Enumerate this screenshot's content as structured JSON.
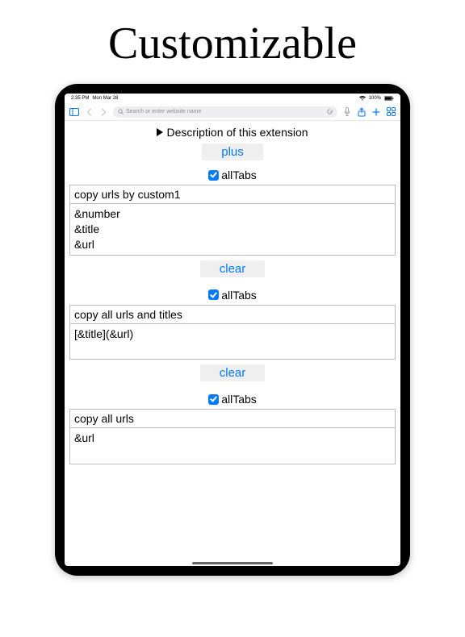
{
  "hero": {
    "title": "Customizable"
  },
  "statusbar": {
    "time": "2:35 PM",
    "date": "Mon Mar 28",
    "battery": "100%"
  },
  "toolbar": {
    "search_placeholder": "Search or enter website name"
  },
  "page": {
    "description_label": "Description of this extension",
    "plus_label": "plus",
    "clear_label": "clear",
    "alltabs_label": "allTabs",
    "sections": [
      {
        "title": "copy urls by custom1",
        "template": "&number\n&title\n&url",
        "template_rows": 3
      },
      {
        "title": "copy all urls and titles",
        "template": "[&title](&url)",
        "template_rows": 2
      },
      {
        "title": "copy all urls",
        "template": "&url",
        "template_rows": 2
      }
    ]
  }
}
